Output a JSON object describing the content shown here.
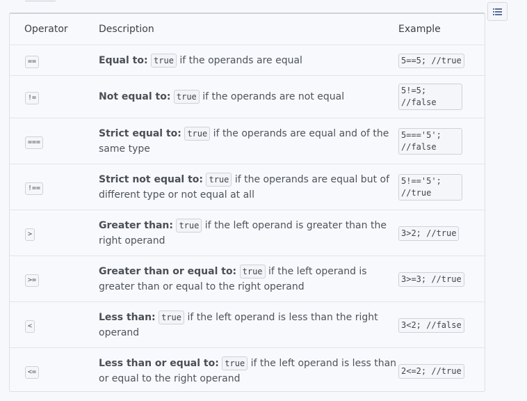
{
  "table": {
    "headers": {
      "operator": "Operator",
      "description": "Description",
      "example": "Example"
    },
    "rows": [
      {
        "op": "==",
        "term": "Equal to:",
        "code": "true",
        "rest": " if the operands are equal",
        "example": "5==5; //true",
        "wrap": false
      },
      {
        "op": "!=",
        "term": "Not equal to:",
        "code": "true",
        "rest": " if the operands are not equal",
        "example": "5!=5;\n//false",
        "wrap": true
      },
      {
        "op": "===",
        "term": "Strict equal to:",
        "code": "true",
        "rest": " if the operands are equal and of the same type",
        "example": "5==='5';\n//false",
        "wrap": true
      },
      {
        "op": "!==",
        "term": "Strict not equal to:",
        "code": "true",
        "rest": " if the operands are equal but of different type or not equal at all",
        "example": "5!=='5';\n//true",
        "wrap": true
      },
      {
        "op": ">",
        "term": "Greater than:",
        "code": "true",
        "rest": " if the left operand is greater than the right operand",
        "example": "3>2; //true",
        "wrap": false
      },
      {
        "op": ">=",
        "term": "Greater than or equal to:",
        "code": "true",
        "rest": " if the left operand is greater than or equal to the right operand",
        "example": "3>=3; //true",
        "wrap": false
      },
      {
        "op": "<",
        "term": "Less than:",
        "code": "true",
        "rest": " if the left operand is less than the right operand",
        "example": "3<2; //false",
        "wrap": false
      },
      {
        "op": "<=",
        "term": "Less than or equal to:",
        "code": "true",
        "rest": " if the left operand is less than or equal to the right operand",
        "example": "2<=2; //true",
        "wrap": false
      }
    ]
  },
  "toc_icon": "list-icon"
}
